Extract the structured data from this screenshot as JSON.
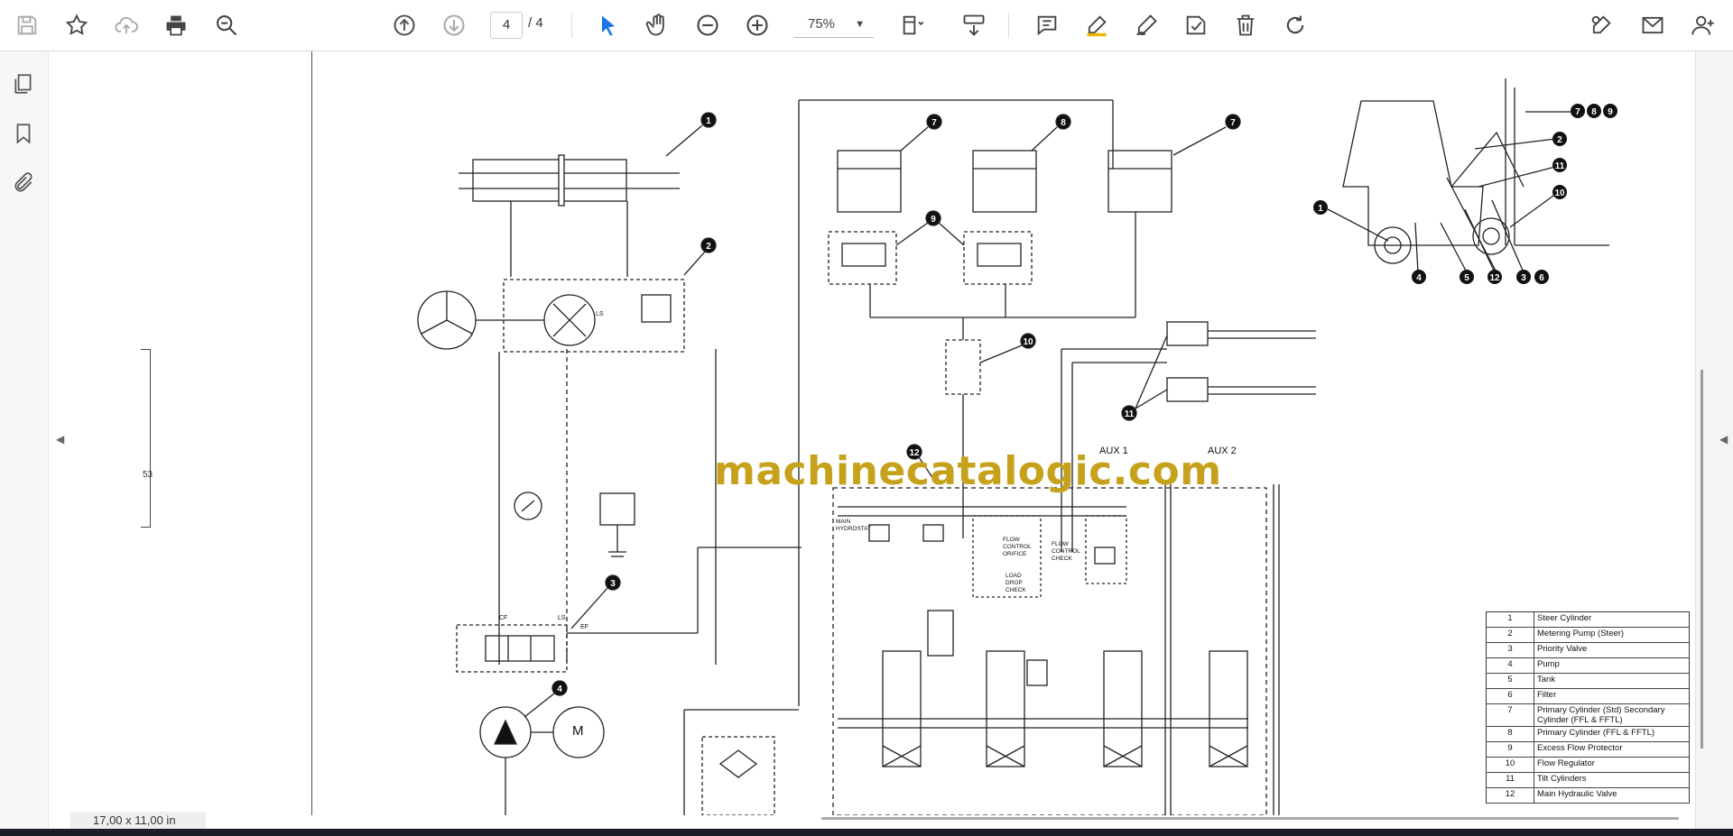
{
  "toolbar": {
    "page_current": "4",
    "page_separator": "/ 4",
    "zoom": "75%",
    "icons": [
      "save-icon",
      "bookmark-star-icon",
      "upload-cloud-icon",
      "print-icon",
      "zoom-search-icon",
      "page-up-icon",
      "page-down-icon",
      "select-cursor-icon",
      "hand-tool-icon",
      "zoom-out-icon",
      "zoom-in-icon",
      "fit-page-icon",
      "scroll-mode-icon",
      "comment-icon",
      "highlight-pen-icon",
      "draw-icon",
      "stamp-icon",
      "delete-icon",
      "rotate-icon",
      "sign-icon",
      "email-icon",
      "add-user-icon"
    ]
  },
  "sidebar": {
    "icons": [
      "pages-icon",
      "bookmark-icon",
      "attachment-icon"
    ]
  },
  "document": {
    "watermark": "machinecatalogic.com",
    "scroll_label": "53",
    "labels": {
      "aux1": "AUX 1",
      "aux2": "AUX 2",
      "main_hydrostat": "MAIN HYDROSTAT",
      "flow_control_orifice": "FLOW CONTROL ORIFICE",
      "flow_control_check": "FLOW CONTROL CHECK",
      "load_drop_check": "LOAD DROP CHECK",
      "motor": "M",
      "ls": "LS",
      "ef": "EF",
      "cf": "CF"
    },
    "legend": [
      {
        "num": "1",
        "text": "Steer Cylinder"
      },
      {
        "num": "2",
        "text": "Metering Pump (Steer)"
      },
      {
        "num": "3",
        "text": "Priority Valve"
      },
      {
        "num": "4",
        "text": "Pump"
      },
      {
        "num": "5",
        "text": "Tank"
      },
      {
        "num": "6",
        "text": "Filter"
      },
      {
        "num": "7",
        "text": "Primary Cylinder (Std) Secondary Cylinder (FFL & FFTL)"
      },
      {
        "num": "8",
        "text": "Primary Cylinder (FFL & FFTL)"
      },
      {
        "num": "9",
        "text": "Excess Flow Protector"
      },
      {
        "num": "10",
        "text": "Flow Regulator"
      },
      {
        "num": "11",
        "text": "Tilt Cylinders"
      },
      {
        "num": "12",
        "text": "Main Hydraulic Valve"
      }
    ]
  },
  "status": {
    "page_size": "17,00 x 11,00 in"
  }
}
